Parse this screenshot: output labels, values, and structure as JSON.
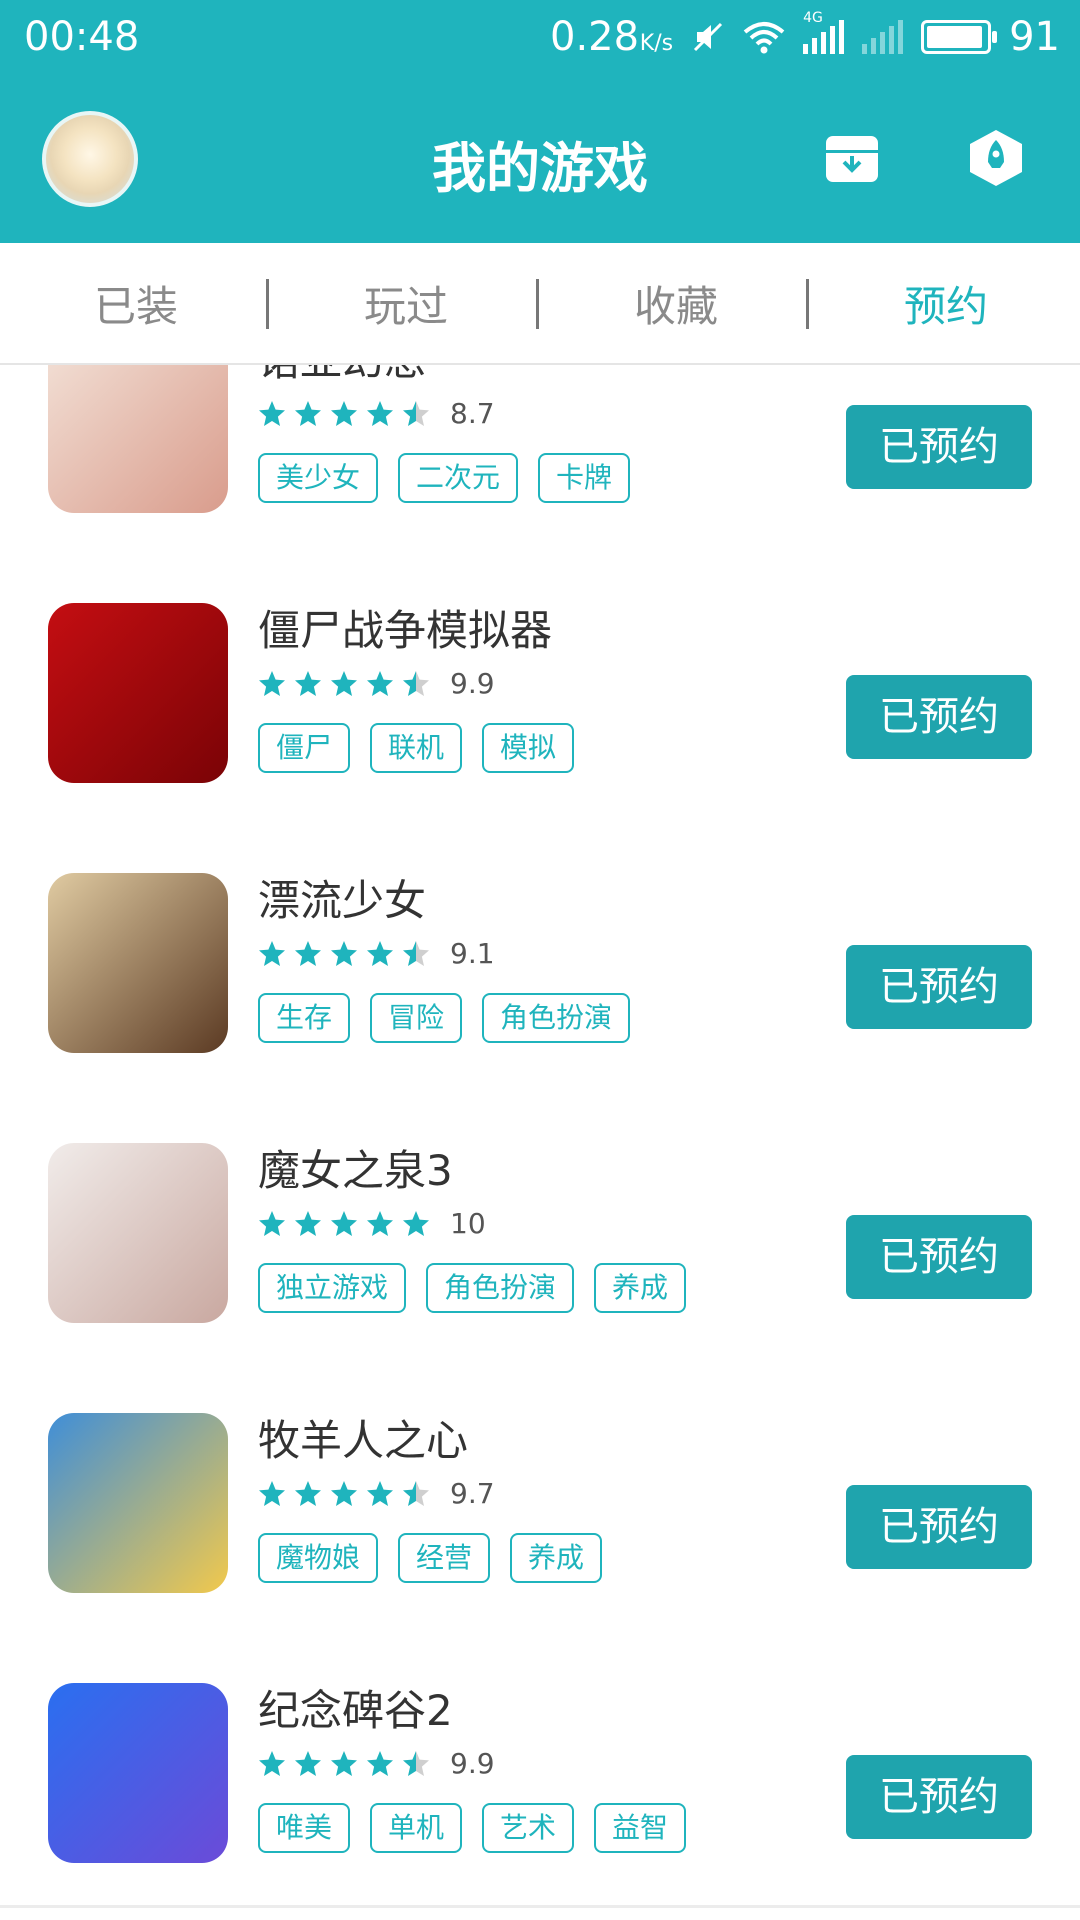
{
  "status_bar": {
    "time": "00:48",
    "net_speed": "0.28",
    "net_unit": "K/s",
    "network": "4G",
    "battery": "91"
  },
  "header": {
    "title": "我的游戏"
  },
  "tabs": [
    {
      "label": "已装"
    },
    {
      "label": "玩过"
    },
    {
      "label": "收藏"
    },
    {
      "label": "预约",
      "active": true
    }
  ],
  "games": [
    {
      "name": "诺亚幻想",
      "rating": 8.7,
      "score": "8.7",
      "tags": [
        "美少女",
        "二次元",
        "卡牌"
      ],
      "button": "已预约",
      "icon_colors": [
        "#f3e2d8",
        "#d99c8c"
      ]
    },
    {
      "name": "僵尸战争模拟器",
      "rating": 9.9,
      "score": "9.9",
      "tags": [
        "僵尸",
        "联机",
        "模拟"
      ],
      "button": "已预约",
      "icon_colors": [
        "#c40e12",
        "#7a0306"
      ]
    },
    {
      "name": "漂流少女",
      "rating": 9.1,
      "score": "9.1",
      "tags": [
        "生存",
        "冒险",
        "角色扮演"
      ],
      "button": "已预约",
      "icon_colors": [
        "#e0cba2",
        "#5b3a23"
      ]
    },
    {
      "name": "魔女之泉3",
      "rating": 10,
      "score": "10",
      "tags": [
        "独立游戏",
        "角色扮演",
        "养成"
      ],
      "button": "已预约",
      "icon_colors": [
        "#f1ecea",
        "#c9a8a0"
      ]
    },
    {
      "name": "牧羊人之心",
      "rating": 9.7,
      "score": "9.7",
      "tags": [
        "魔物娘",
        "经营",
        "养成"
      ],
      "button": "已预约",
      "icon_colors": [
        "#3f8ed8",
        "#f2c94c"
      ]
    },
    {
      "name": "纪念碑谷2",
      "rating": 9.9,
      "score": "9.9",
      "tags": [
        "唯美",
        "单机",
        "艺术",
        "益智"
      ],
      "button": "已预约",
      "icon_colors": [
        "#2a6ff0",
        "#6b4bd8"
      ]
    }
  ]
}
